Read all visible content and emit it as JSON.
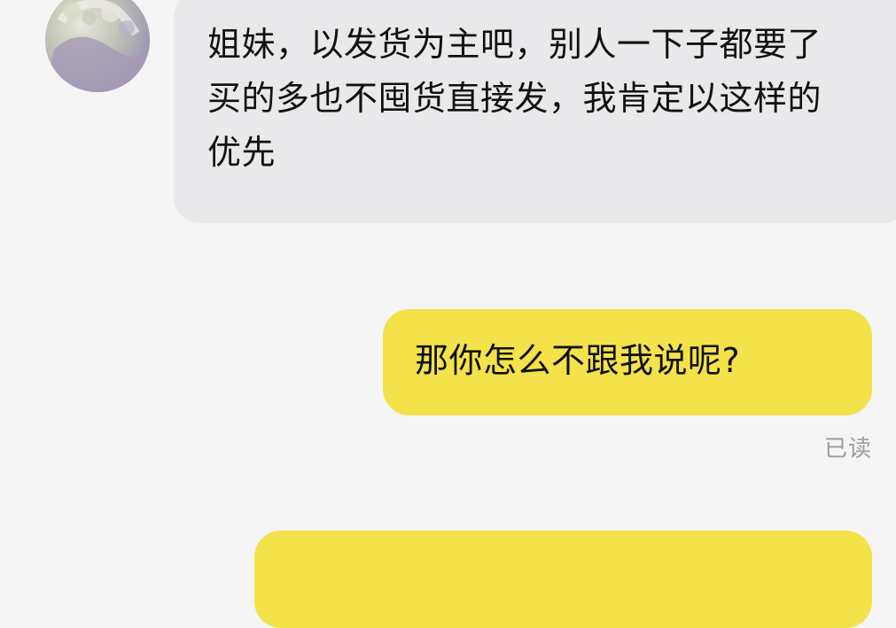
{
  "conversation": {
    "incoming": {
      "text": "姐妹，以发货为主吧，别人一下子都要了买的多也不囤货直接发，我肯定以这样的优先",
      "avatar_icon": "avatar-photo-icon"
    },
    "outgoing": {
      "text": "那你怎么不跟我说呢?",
      "read_status": "已读"
    }
  },
  "colors": {
    "background": "#f5f5f5",
    "incoming_bubble": "#e9e9eb",
    "outgoing_bubble": "#f4e24a",
    "read_text": "#9c9c9c",
    "message_text": "#111111"
  }
}
